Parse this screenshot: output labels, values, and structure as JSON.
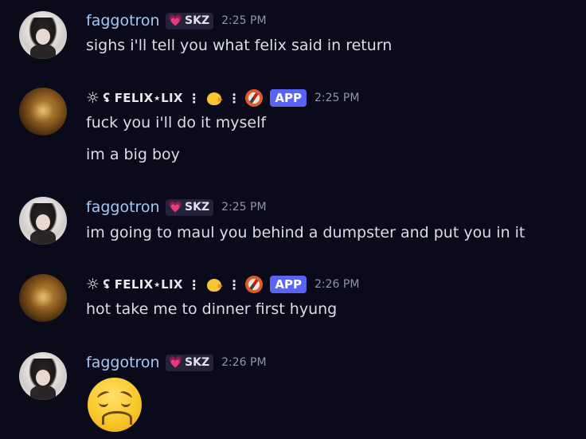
{
  "messages": [
    {
      "author": "faggotron",
      "tag_icon": "heart-icon",
      "tag": "SKZ",
      "time": "2:25 PM",
      "lines": [
        "sighs i'll tell you what felix said in return"
      ]
    },
    {
      "author_prefix_icon": "sun-icon",
      "author": "ʢ FELIX⋆LIX",
      "author_sep": "⋮",
      "author_icons": [
        "baby-chick-icon",
        "compass-icon"
      ],
      "badge": "APP",
      "time": "2:25 PM",
      "lines": [
        "fuck you i'll do it myself",
        "im a big boy"
      ]
    },
    {
      "author": "faggotron",
      "tag": "SKZ",
      "time": "2:25 PM",
      "lines": [
        "im going to maul you behind a dumpster and put you in it"
      ]
    },
    {
      "author": "ʢ FELIX⋆LIX",
      "author_sep": "⋮",
      "badge": "APP",
      "time": "2:26 PM",
      "lines": [
        "hot take me to dinner first hyung"
      ]
    },
    {
      "author": "faggotron",
      "tag": "SKZ",
      "time": "2:26 PM",
      "emoji": "confounded-face-emoji"
    }
  ],
  "colors": {
    "background": "#0b0a1b",
    "username": "#a5c8f0",
    "app_badge": "#5865f2",
    "timestamp": "#9395a6"
  }
}
